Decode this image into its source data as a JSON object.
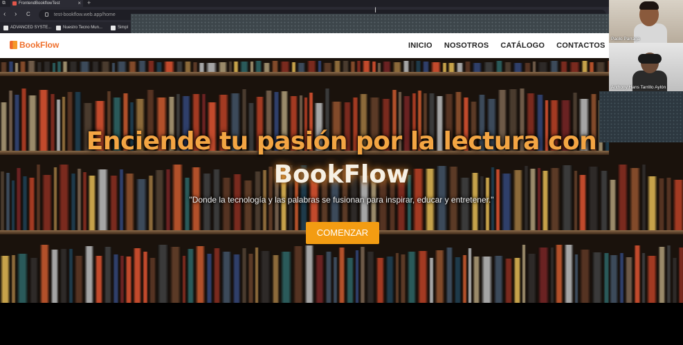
{
  "browser": {
    "tab_title": "FrontendBookflowTest",
    "new_tab_symbol": "+",
    "close_symbol": "×",
    "nav": {
      "back": "‹",
      "forward": "›",
      "reload": "C"
    },
    "url": "test-bookflow.web.app/home",
    "bookmarks": [
      {
        "label": "ADVANCED SYSTE..."
      },
      {
        "label": "Nuestro Tecno Mun..."
      },
      {
        "label": "Simpl"
      }
    ]
  },
  "site": {
    "logo_text": "BookFlow",
    "nav_links": [
      "INICIO",
      "NOSOTROS",
      "CATÁLOGO",
      "CONTACTOS"
    ]
  },
  "hero": {
    "title_line1": "Enciende tu pasión por la lectura con",
    "title_line2": "BookFlow",
    "subtitle": "\"Donde la tecnología y las palabras se fusionan para inspirar, educar y entretener.\"",
    "cta_label": "COMENZAR"
  },
  "meeting": {
    "participants": [
      {
        "name": "Paolo Parraga"
      },
      {
        "name": "Anthony Hans Tarrillo Aylón"
      }
    ]
  },
  "colors": {
    "accent": "#f39c12",
    "title_orange": "#f3a543",
    "logo_orange": "#ef6f2b"
  }
}
